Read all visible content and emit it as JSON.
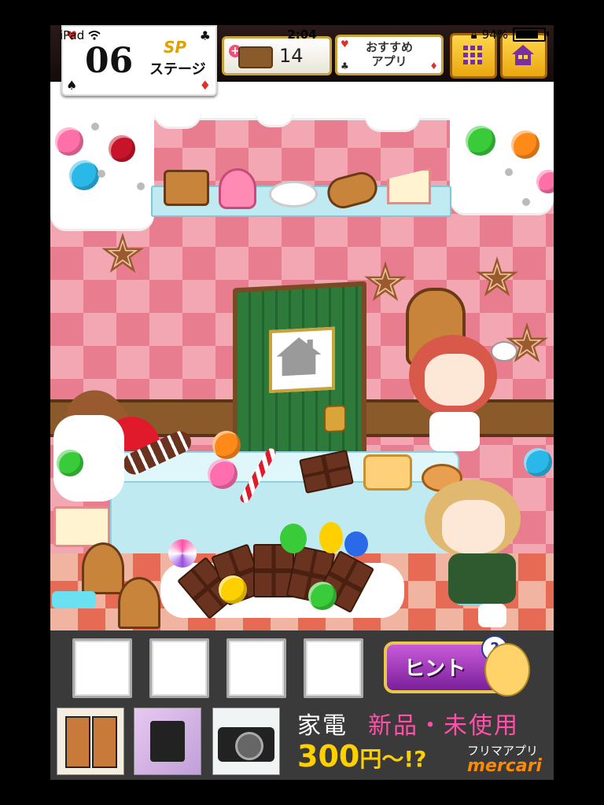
{
  "status_bar": {
    "carrier": "iPad",
    "time": "2:04",
    "battery_text": "94%",
    "battery_level": 0.94
  },
  "header": {
    "stage_number": "06",
    "stage_prefix": "SP",
    "stage_label": "ステージ",
    "coin_count": "14",
    "recommend_line1": "おすすめ",
    "recommend_line2": "アプリ"
  },
  "icons": {
    "wifi": "wifi-icon",
    "lock": "rotation-lock-icon",
    "battery": "battery-icon",
    "plus": "plus-icon",
    "cake": "cake-coin-icon",
    "grid": "stage-grid-icon",
    "home": "home-icon",
    "question": "question-icon",
    "house_sign": "house-sign-icon"
  },
  "items": {
    "slots": [
      "",
      "",
      "",
      ""
    ]
  },
  "hint": {
    "label": "ヒント",
    "badge": "?"
  },
  "ad": {
    "line1_white": "家電",
    "line1_pink": "新品・未使用",
    "price": "300",
    "price_suffix": "円〜!?",
    "app_label": "フリマアプリ",
    "brand": "mercari"
  },
  "colors": {
    "wall_pink": "#f3a7b3",
    "wall_dark_pink": "#e77d8e",
    "door_green": "#2e7a3b",
    "hint_purple": "#a23bc0",
    "ad_yellow": "#ffd000",
    "ad_pink": "#ff4fa8",
    "brand_orange": "#ff8a00"
  }
}
